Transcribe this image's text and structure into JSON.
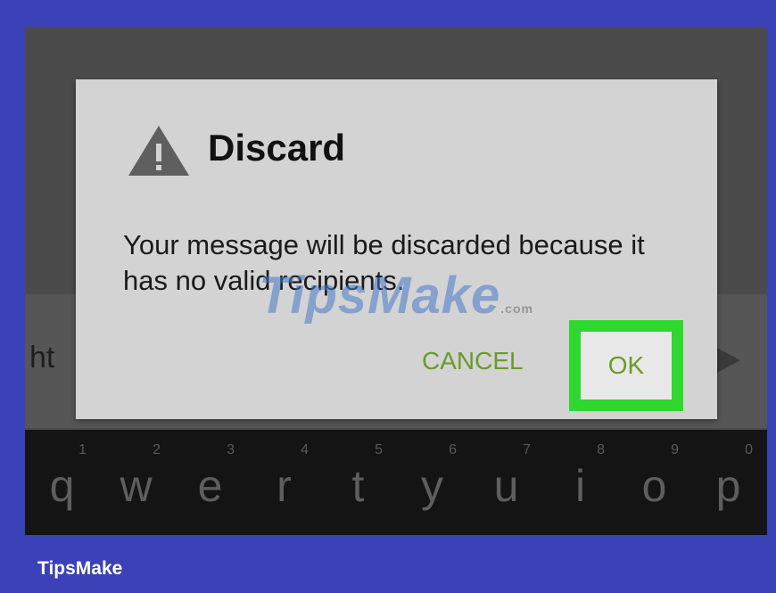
{
  "background_text": "ht",
  "dialog": {
    "title": "Discard",
    "message": "Your message will be discarded because it has no valid recipients.",
    "cancel_label": "CANCEL",
    "ok_label": "OK"
  },
  "keyboard": {
    "keys": [
      {
        "num": "1",
        "char": "q"
      },
      {
        "num": "2",
        "char": "w"
      },
      {
        "num": "3",
        "char": "e"
      },
      {
        "num": "4",
        "char": "r"
      },
      {
        "num": "5",
        "char": "t"
      },
      {
        "num": "6",
        "char": "y"
      },
      {
        "num": "7",
        "char": "u"
      },
      {
        "num": "8",
        "char": "i"
      },
      {
        "num": "9",
        "char": "o"
      },
      {
        "num": "0",
        "char": "p"
      }
    ]
  },
  "watermark": {
    "text": "TipsMake",
    "suffix": ".com"
  },
  "brand": "TipsMake",
  "colors": {
    "frame": "#3b41b7",
    "dialog_bg": "#d3d3d3",
    "button_text": "#6a9a2a",
    "highlight": "#2ed82e"
  },
  "icons": [
    "warning-icon",
    "send-icon"
  ]
}
